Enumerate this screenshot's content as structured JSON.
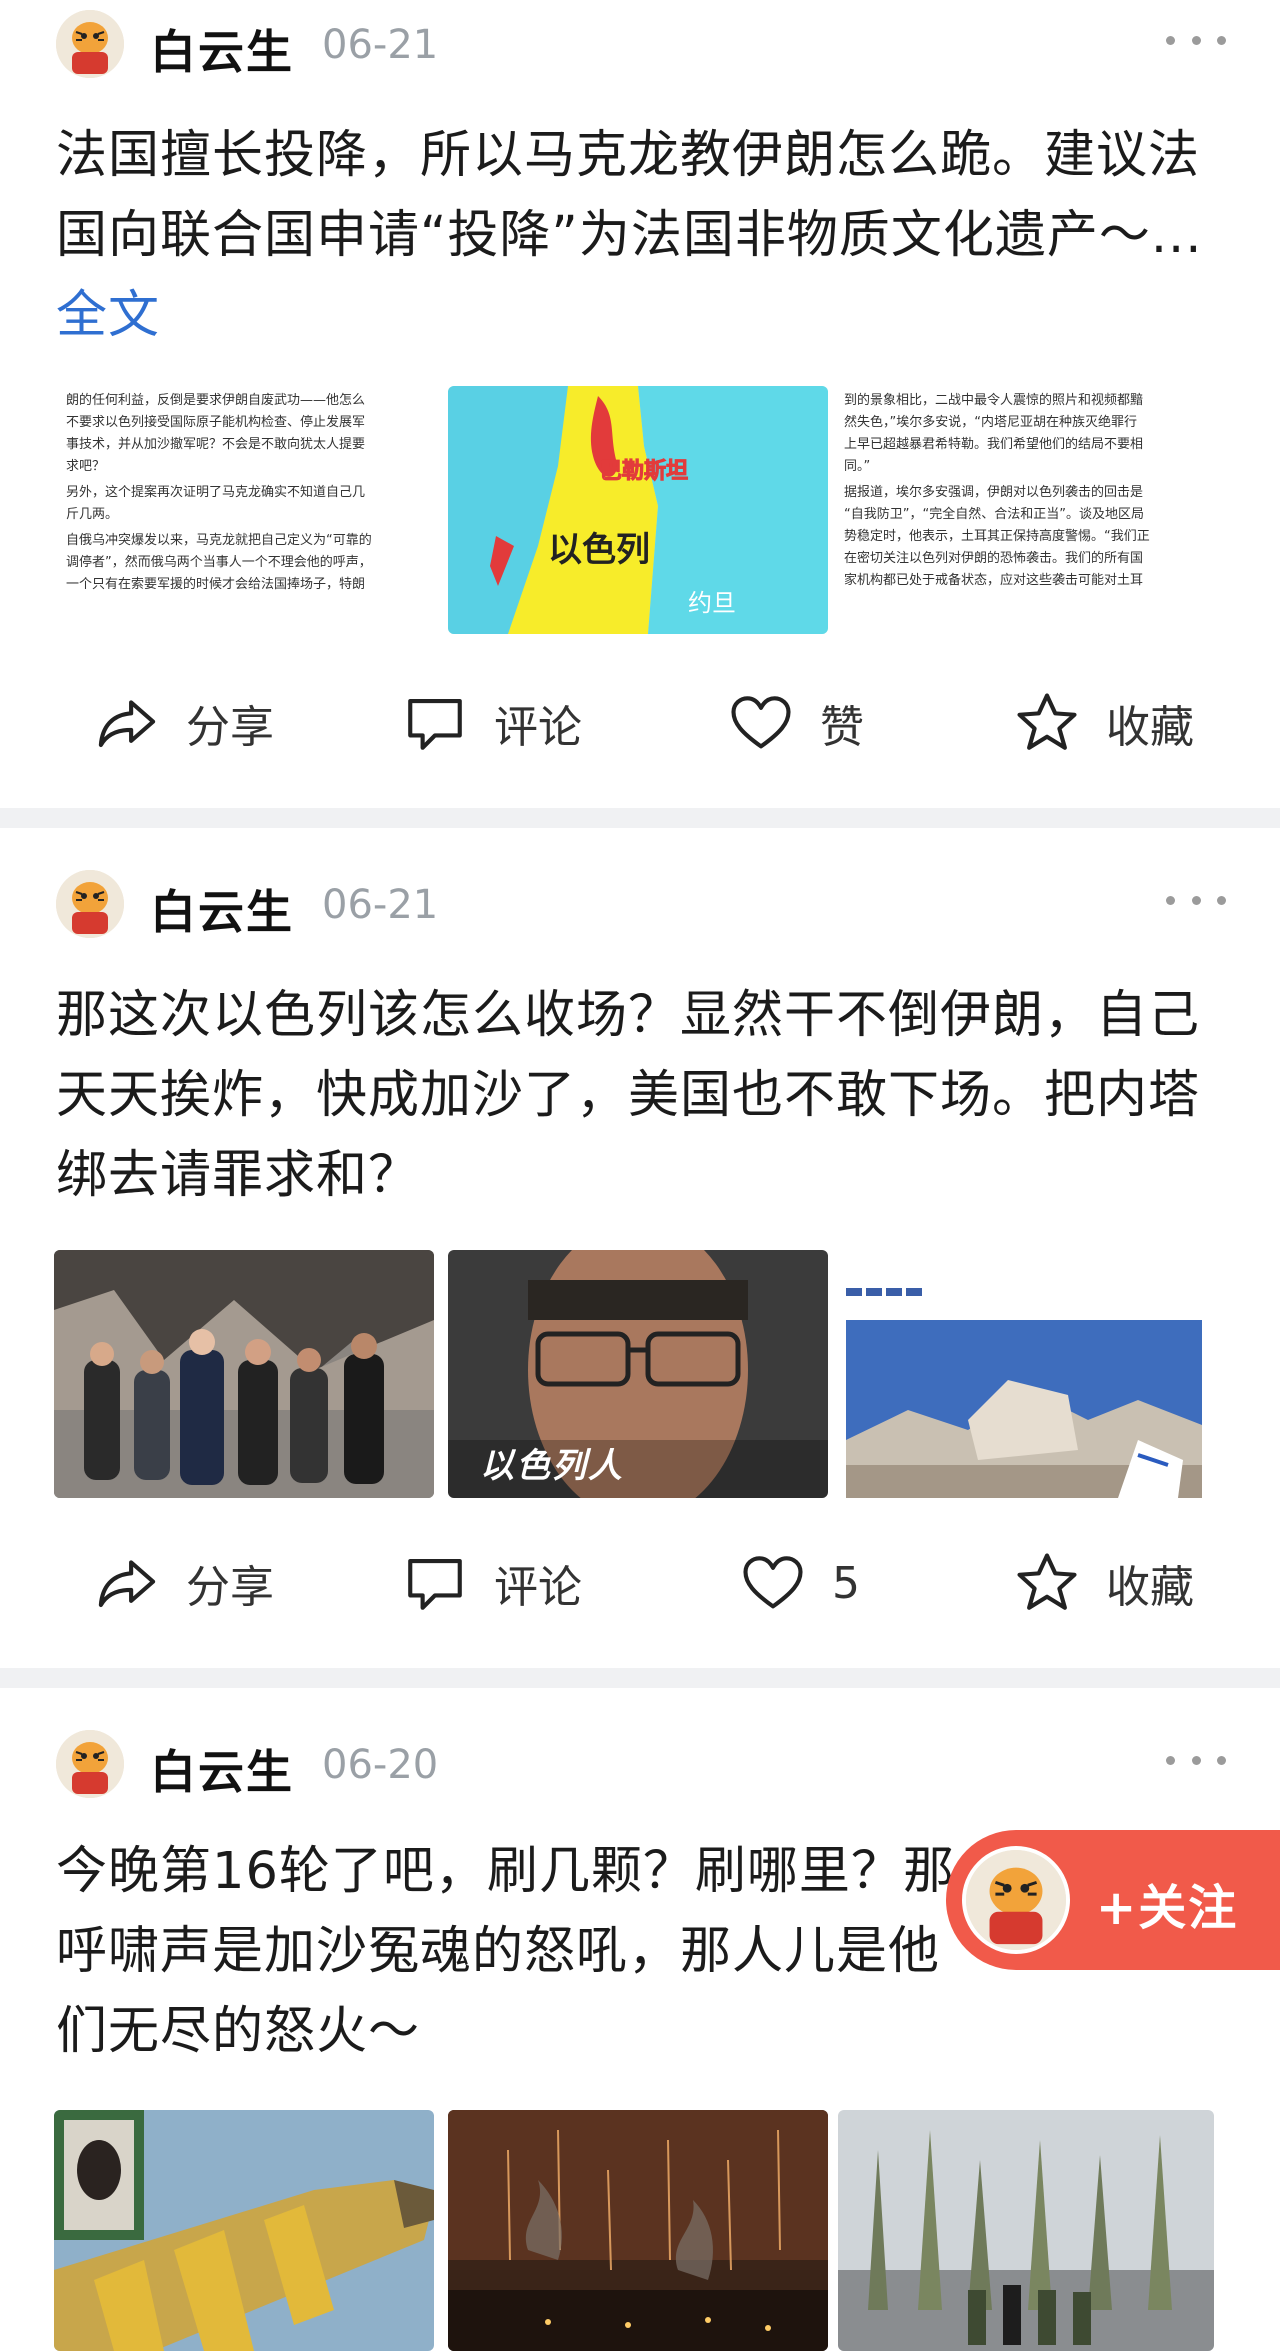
{
  "posts": [
    {
      "author": "白云生",
      "date": "06-21",
      "text": "法国擅长投降，所以马克龙教伊朗怎么跪。建议法国向联合国申请“投降”为法国非物质文化遗产～...",
      "full_text_link": "全文",
      "images": [
        {
          "lines": [
            "朗的任何利益，反倒是要求伊朗自废武功——他怎么",
            "不要求以色列接受国际原子能机构检查、停止发展军",
            "事技术，并从加沙撤军呢？不会是不敢向犹太人提要",
            "求吧？",
            "另外，这个提案再次证明了马克龙确实不知道自己几",
            "斤几两。",
            "自俄乌冲突爆发以来，马克龙就把自己定义为“可靠的",
            "调停者”，然而俄乌两个当事人一个不理会他的呼声，",
            "一个只有在索要军援的时候才会给法国捧场子，特朗"
          ]
        },
        {
          "labels": [
            "巴勒斯坦",
            "以色列",
            "约旦"
          ]
        },
        {
          "lines": [
            "到的景象相比，二战中最令人震惊的照片和视频都黯",
            "然失色，”埃尔多安说，“内塔尼亚胡在种族灭绝罪行",
            "上早已超越暴君希特勒。我们希望他们的结局不要相",
            "同。”",
            "据报道，埃尔多安强调，伊朗对以色列袭击的回击是",
            "“自我防卫”，“完全自然、合法和正当”。谈及地区局",
            "势稳定时，他表示，土耳其正保持高度警惕。“我们正",
            "在密切关注以色列对伊朗的恐怖袭击。我们的所有国",
            "家机构都已处于戒备状态，应对这些袭击可能对土耳"
          ]
        }
      ],
      "actions": {
        "share": "分享",
        "comment": "评论",
        "like": "赞",
        "favorite": "收藏"
      }
    },
    {
      "author": "白云生",
      "date": "06-21",
      "text": "那这次以色列该怎么收场？显然干不倒伊朗，自己天天挨炸，快成加沙了，美国也不敢下场。把内塔绑去请罪求和？",
      "images": [
        {},
        {
          "caption": "以色列人"
        },
        {}
      ],
      "actions": {
        "share": "分享",
        "comment": "评论",
        "like": "5",
        "favorite": "收藏"
      }
    },
    {
      "author": "白云生",
      "date": "06-20",
      "text": "今晚第16轮了吧，刷几颗？刷哪里？那呼啸声是加沙冤魂的怒吼，那人儿是他们无尽的怒火～",
      "images": [
        {},
        {},
        {}
      ]
    }
  ],
  "follow_button": {
    "label": "+关注"
  },
  "colors": {
    "accent_link": "#2f6fd1",
    "follow_bg": "#f15a4a",
    "divider": "#f0f1f3"
  }
}
